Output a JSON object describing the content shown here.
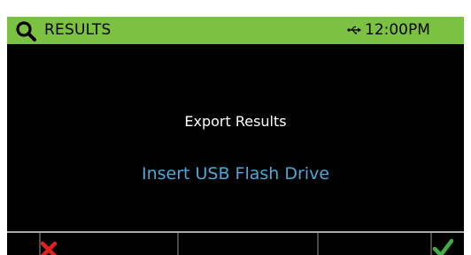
{
  "header": {
    "title": "RESULTS",
    "time": "12:00PM",
    "left_icon": "search-icon",
    "status_icon": "usb-icon",
    "background_color": "#7cc242"
  },
  "dialog": {
    "title": "Export Results",
    "message": "Insert USB Flash Drive",
    "message_color": "#4aa8d8"
  },
  "softkeys": {
    "left_icon": "close-icon",
    "left_color": "#e02020",
    "right_icon": "checkmark-icon",
    "right_color": "#3fae49"
  }
}
